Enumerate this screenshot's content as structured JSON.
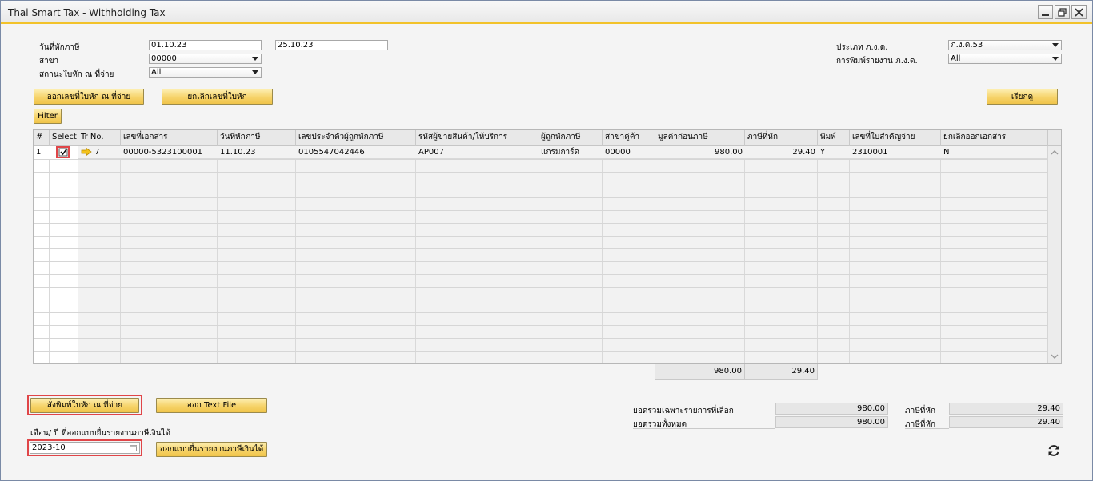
{
  "window": {
    "title": "Thai Smart Tax - Withholding Tax"
  },
  "form": {
    "date_label": "วันที่หักภาษี",
    "date_from": "01.10.23",
    "date_to": "25.10.23",
    "branch_label": "สาขา",
    "branch_value": "00000",
    "status_label": "สถานะใบหัก ณ ที่จ่าย",
    "status_value": "All",
    "type_label": "ประเภท ภ.ง.ด.",
    "type_value": "ภ.ง.ด.53",
    "print_label": "การพิมพ์รายงาน ภ.ง.ด.",
    "print_value": "All"
  },
  "buttons": {
    "issue": "ออกเลขที่ใบหัก ณ ที่จ่าย",
    "cancel": "ยกเลิกเลขที่ใบหัก",
    "fetch": "เรียกดู",
    "filter": "Filter",
    "print_cert": "สั่งพิมพ์ใบหัก ณ ที่จ่าย",
    "text_file": "ออก Text File",
    "report": "ออกแบบยื่นรายงานภาษีเงินได้"
  },
  "grid": {
    "headers": [
      "#",
      "Select",
      "Tr No.",
      "เลขที่เอกสาร",
      "วันที่หักภาษี",
      "เลขประจำตัวผู้ถูกหักภาษี",
      "รหัสผู้ขายสินค้า/ให้บริการ",
      "ผู้ถูกหักภาษี",
      "สาขาคู่ค้า",
      "มูลค่าก่อนภาษี",
      "ภาษีที่หัก",
      "พิมพ์",
      "เลขที่ใบสำคัญจ่าย",
      "ยกเลิกออกเอกสาร"
    ],
    "rows": [
      {
        "num": "1",
        "selected": true,
        "trno": "7",
        "doc": "00000-5323100001",
        "date": "11.10.23",
        "taxid": "0105547042446",
        "vendor": "AP007",
        "name": "แกรมการ์ด",
        "branch": "00000",
        "amount": "980.00",
        "tax": "29.40",
        "printed": "Y",
        "voucher": "2310001",
        "cancel": "N"
      }
    ],
    "total_amount": "980.00",
    "total_tax": "29.40"
  },
  "bottom": {
    "month_label": "เดือน/ ปี ที่ออกแบบยื่นรายงานภาษีเงินได้",
    "month_value": "2023-10",
    "sum_selected_label": "ยอดรวมเฉพาะรายการที่เลือก",
    "sum_selected_value": "980.00",
    "tax_selected_label": "ภาษีที่หัก",
    "tax_selected_value": "29.40",
    "sum_all_label": "ยอดรวมทั้งหมด",
    "sum_all_value": "980.00",
    "tax_all_label": "ภาษีที่หัก",
    "tax_all_value": "29.40"
  },
  "icons": [
    "minimize-icon",
    "restore-icon",
    "close-icon",
    "arrow-right-icon",
    "checkmark-icon",
    "calendar-icon",
    "refresh-icon"
  ],
  "colors": {
    "accent": "#f2c22a",
    "button": "#f6d36a",
    "highlight": "#e04548"
  }
}
